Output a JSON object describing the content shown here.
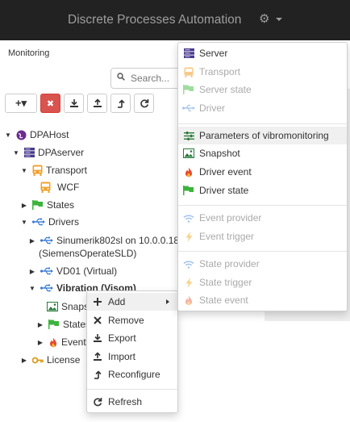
{
  "navbar": {
    "title": "Discrete Processes Automation",
    "cog_glyph": "⚙"
  },
  "section_label": "Monitoring",
  "search": {
    "placeholder": "Search..."
  },
  "toolbar": {
    "add_glyph": "+▾",
    "remove_glyph": "✖"
  },
  "tree": {
    "root": "DPAHost",
    "server": "DPAserver",
    "transport": "Transport",
    "wcf": "WCF",
    "states": "States",
    "drivers": "Drivers",
    "driver1_line1": "Sinumerik802sl on 10.0.0.18",
    "driver1_line2": "(SiemensOperateSLD)",
    "driver2": "VD01 (Virtual)",
    "driver3": "Vibration (Visom)",
    "child_snapshot": "Snapshot",
    "child_states": "States",
    "child_events": "Events",
    "license": "License"
  },
  "context_menu": {
    "add": "Add",
    "remove": "Remove",
    "export": "Export",
    "import": "Import",
    "reconfigure": "Reconfigure",
    "refresh": "Refresh"
  },
  "submenu": {
    "server": "Server",
    "transport": "Transport",
    "server_state": "Server state",
    "driver": "Driver",
    "params": "Parameters of vibromonitoring",
    "snapshot": "Snapshot",
    "driver_event": "Driver event",
    "driver_state": "Driver state",
    "event_provider": "Event provider",
    "event_trigger": "Event trigger",
    "state_provider": "State provider",
    "state_trigger": "State trigger",
    "state_event": "State event"
  },
  "colors": {
    "navbar": "#222222",
    "danger": "#d9534f",
    "orange": "#f0a030",
    "green": "#3cb43c",
    "blue": "#3a7bd5",
    "purple": "#6a2c91",
    "server": "#4a3a8a"
  }
}
